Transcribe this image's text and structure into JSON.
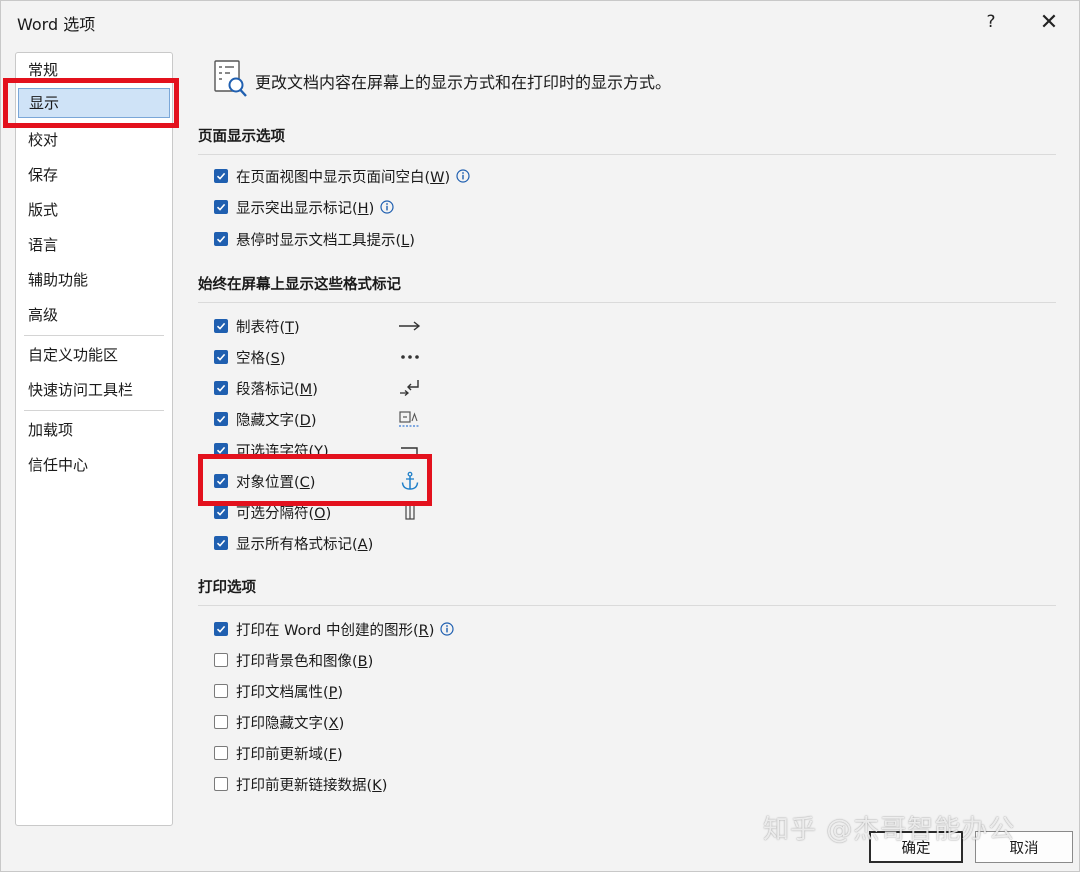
{
  "window": {
    "title": "Word 选项",
    "help_label": "?",
    "close_label": "✕"
  },
  "sidebar": {
    "items": [
      {
        "label": "常规"
      },
      {
        "label": "显示",
        "selected": true
      },
      {
        "label": "校对"
      },
      {
        "label": "保存"
      },
      {
        "label": "版式"
      },
      {
        "label": "语言"
      },
      {
        "label": "辅助功能"
      },
      {
        "label": "高级"
      },
      {
        "label": "自定义功能区"
      },
      {
        "label": "快速访问工具栏"
      },
      {
        "label": "加载项"
      },
      {
        "label": "信任中心"
      }
    ]
  },
  "main": {
    "header": "更改文档内容在屏幕上的显示方式和在打印时的显示方式。",
    "sections": [
      {
        "title": "页面显示选项",
        "options": [
          {
            "label": "在页面视图中显示页面间空白",
            "key": "W",
            "checked": true,
            "info": true
          },
          {
            "label": "显示突出显示标记",
            "key": "H",
            "checked": true,
            "info": true
          },
          {
            "label": "悬停时显示文档工具提示",
            "key": "L",
            "checked": true
          }
        ]
      },
      {
        "title": "始终在屏幕上显示这些格式标记",
        "options": [
          {
            "label": "制表符",
            "key": "T",
            "checked": true,
            "mark": "tab-arrow-icon"
          },
          {
            "label": "空格",
            "key": "S",
            "checked": true,
            "mark": "space-dots-icon"
          },
          {
            "label": "段落标记",
            "key": "M",
            "checked": true,
            "mark": "paragraph-mark-icon"
          },
          {
            "label": "隐藏文字",
            "key": "D",
            "checked": true,
            "mark": "hidden-text-icon"
          },
          {
            "label": "可选连字符",
            "key": "Y",
            "checked": true,
            "mark": "optional-hyphen-icon"
          },
          {
            "label": "对象位置",
            "key": "C",
            "checked": true,
            "mark": "anchor-icon"
          },
          {
            "label": "可选分隔符",
            "key": "O",
            "checked": true,
            "mark": "optional-break-icon"
          },
          {
            "label": "显示所有格式标记",
            "key": "A",
            "checked": true
          }
        ]
      },
      {
        "title": "打印选项",
        "options": [
          {
            "label": "打印在 Word 中创建的图形",
            "key": "R",
            "checked": true,
            "info": true
          },
          {
            "label": "打印背景色和图像",
            "key": "B",
            "checked": false
          },
          {
            "label": "打印文档属性",
            "key": "P",
            "checked": false
          },
          {
            "label": "打印隐藏文字",
            "key": "X",
            "checked": false
          },
          {
            "label": "打印前更新域",
            "key": "F",
            "checked": false
          },
          {
            "label": "打印前更新链接数据",
            "key": "K",
            "checked": false
          }
        ]
      }
    ]
  },
  "footer": {
    "ok_label": "确定",
    "cancel_label": "取消"
  },
  "watermark": "知乎 @杰哥智能办公",
  "colors": {
    "checkbox_checked": "#1f5fb0",
    "highlight_box": "#e3111d",
    "selected_nav": "#cfe3f7",
    "info_icon": "#1f5fb0",
    "anchor_icon": "#1f7fc9"
  }
}
